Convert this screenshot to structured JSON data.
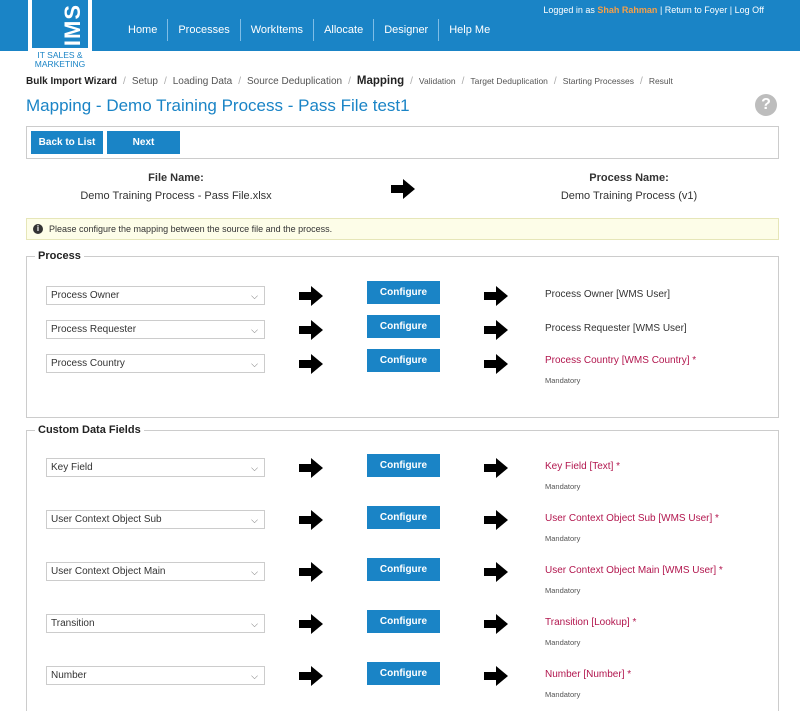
{
  "logo": {
    "letters": "EIMS",
    "sub1": "IT SALES &",
    "sub2": "MARKETING"
  },
  "nav": [
    "Home",
    "Processes",
    "WorkItems",
    "Allocate",
    "Designer",
    "Help Me"
  ],
  "user": {
    "prefix": "Logged in as",
    "name": "Shah Rahman",
    "suffix": "| Return to Foyer | Log Off"
  },
  "wizard": {
    "label": "Bulk Import Wizard",
    "steps": [
      "Setup",
      "Loading Data",
      "Source Deduplication",
      "Mapping",
      "Validation",
      "Target Deduplication",
      "Starting Processes",
      "Result"
    ],
    "active_index": 3
  },
  "page_title": "Mapping - Demo Training Process - Pass File test1",
  "help_icon": "help-icon",
  "buttons": {
    "back": "Back to List",
    "next": "Next"
  },
  "file": {
    "label": "File Name:",
    "value": "Demo Training Process - Pass File.xlsx"
  },
  "process": {
    "label": "Process Name:",
    "value": "Demo Training Process (v1)"
  },
  "notice": "Please configure the mapping between the source file and the process.",
  "configure_label": "Configure",
  "mandatory_label": "Mandatory",
  "sections": [
    {
      "title": "Process",
      "rows": [
        {
          "source": "Process Owner",
          "target": "Process Owner [WMS User]",
          "required": false
        },
        {
          "source": "Process Requester",
          "target": "Process Requester [WMS User]",
          "required": false
        },
        {
          "source": "Process Country",
          "target": "Process Country [WMS Country] *",
          "required": true
        }
      ]
    },
    {
      "title": "Custom Data Fields",
      "rows": [
        {
          "source": "Key Field",
          "target": "Key Field [Text] *",
          "required": true
        },
        {
          "source": "User Context Object Sub",
          "target": "User Context Object Sub [WMS User] *",
          "required": true
        },
        {
          "source": "User Context Object Main",
          "target": "User Context Object Main [WMS User] *",
          "required": true
        },
        {
          "source": "Transition",
          "target": "Transition [Lookup] *",
          "required": true
        },
        {
          "source": "Number",
          "target": "Number [Number] *",
          "required": true
        }
      ]
    }
  ],
  "colors": {
    "brand": "#1a84c6",
    "required": "#b2164e",
    "username": "#f5a04a"
  }
}
